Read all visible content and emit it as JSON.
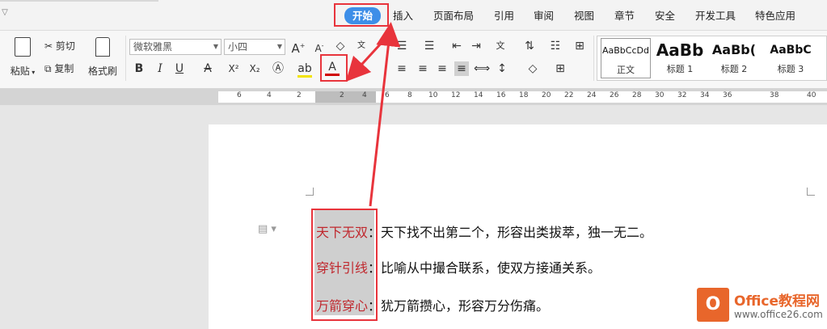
{
  "tabs": [
    {
      "label": "开始",
      "active": true
    },
    {
      "label": "插入"
    },
    {
      "label": "页面布局"
    },
    {
      "label": "引用"
    },
    {
      "label": "审阅"
    },
    {
      "label": "视图"
    },
    {
      "label": "章节"
    },
    {
      "label": "安全"
    },
    {
      "label": "开发工具"
    },
    {
      "label": "特色应用"
    }
  ],
  "ribbon": {
    "paste_label": "粘贴",
    "cut_label": "剪切",
    "copy_label": "复制",
    "format_painter_label": "格式刷",
    "font_name": "微软雅黑",
    "font_size": "小四",
    "font_color_icon": "A",
    "bold": "B",
    "italic": "I",
    "underline": "U",
    "styles": [
      {
        "preview": "AaBbCcDd",
        "name": "正文"
      },
      {
        "preview": "AaBb",
        "name": "标题 1"
      },
      {
        "preview": "AaBb(",
        "name": "标题 2"
      },
      {
        "preview": "AaBbC",
        "name": "标题 3"
      }
    ]
  },
  "ruler": {
    "labels": [
      "6",
      "4",
      "2",
      "2",
      "4",
      "6",
      "8",
      "10",
      "12",
      "14",
      "16",
      "18",
      "20",
      "22",
      "24",
      "26",
      "28",
      "30",
      "32",
      "34",
      "36",
      "38",
      "40"
    ]
  },
  "document": {
    "lines": [
      {
        "idiom": "天下无双",
        "definition": "：天下找不出第二个，形容出类拔萃，独一无二。"
      },
      {
        "idiom": "穿针引线",
        "definition": "：比喻从中撮合联系，使双方接通关系。"
      },
      {
        "idiom": "万箭穿心",
        "definition": "：犹万箭攒心，形容万分伤痛。"
      }
    ]
  },
  "watermark": {
    "title": "Office教程网",
    "url": "www.office26.com"
  },
  "colors": {
    "accent": "#3d8ee8",
    "annotation": "#e8343c",
    "idiom_text": "#c0272d",
    "logo": "#e8662b"
  }
}
